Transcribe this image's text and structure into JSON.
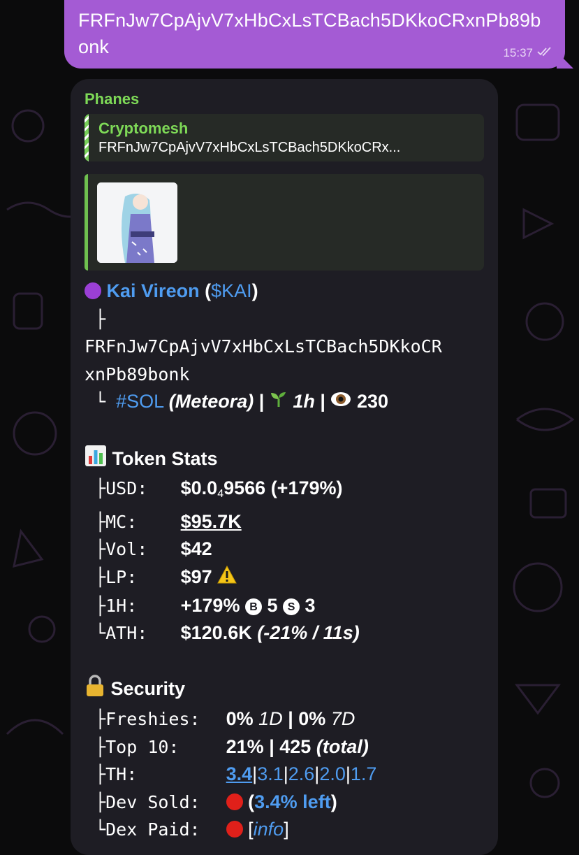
{
  "outgoing": {
    "text": "FRFnJw7CpAjvV7xHbCxLsTCBach5DKkoCRxnPb89bonk",
    "time": "15:37"
  },
  "incoming": {
    "sender": "Phanes",
    "reply": {
      "name": "Cryptomesh",
      "text": "FRFnJw7CpAjvV7xHbCxLsTCBach5DKkoCRx..."
    },
    "token": {
      "name": "Kai Vireon",
      "ticker": "$KAI",
      "address_part1": "FRFnJw7CpAjvV7xHbCxLsTCBach5DKkoCR",
      "address_part2": "xnPb89bonk",
      "chain": "#SOL",
      "dex": "(Meteora)",
      "age": "1h",
      "views": "230"
    },
    "stats": {
      "title": "Token Stats",
      "usd_label": "USD:",
      "usd_pre": "$0.0",
      "usd_sub": "4",
      "usd_post": "9566",
      "usd_change": "(+179%)",
      "mc_label": "MC:",
      "mc_value": "$95.7K",
      "vol_label": "Vol:",
      "vol_value": "$42",
      "lp_label": "LP:",
      "lp_value": "$97",
      "h1_label": "1H:",
      "h1_value": "+179%",
      "buys_icon": "B",
      "buys": "5",
      "sells_icon": "S",
      "sells": "3",
      "ath_label": "ATH:",
      "ath_value": "$120.6K",
      "ath_note": "(-21% / 11s)"
    },
    "security": {
      "title": "Security",
      "freshies_label": "Freshies:",
      "freshies_1d": "0%",
      "freshies_1d_unit": "1D",
      "freshies_7d": "0%",
      "freshies_7d_unit": "7D",
      "top10_label": "Top 10:",
      "top10_pct": "21%",
      "top10_total": "425",
      "top10_total_unit": "(total)",
      "th_label": "TH:",
      "th_values": [
        "3.4",
        "3.1",
        "2.6",
        "2.0",
        "1.7"
      ],
      "devsold_label": "Dev Sold:",
      "devsold_note": "(3.4% left)",
      "dexpaid_label": "Dex Paid:",
      "dexpaid_link": "info"
    }
  },
  "colors": {
    "outgoing_bubble": "#a45bd4",
    "incoming_bubble": "#1e1d24",
    "sender_green": "#7ed957",
    "link_blue": "#4f9cf0",
    "red_status": "#e0201a"
  },
  "icons": [
    "check-double-icon",
    "purple-circle-icon",
    "seedling-icon",
    "eye-icon",
    "bar-chart-icon",
    "warning-icon",
    "lock-icon",
    "red-circle-icon"
  ]
}
